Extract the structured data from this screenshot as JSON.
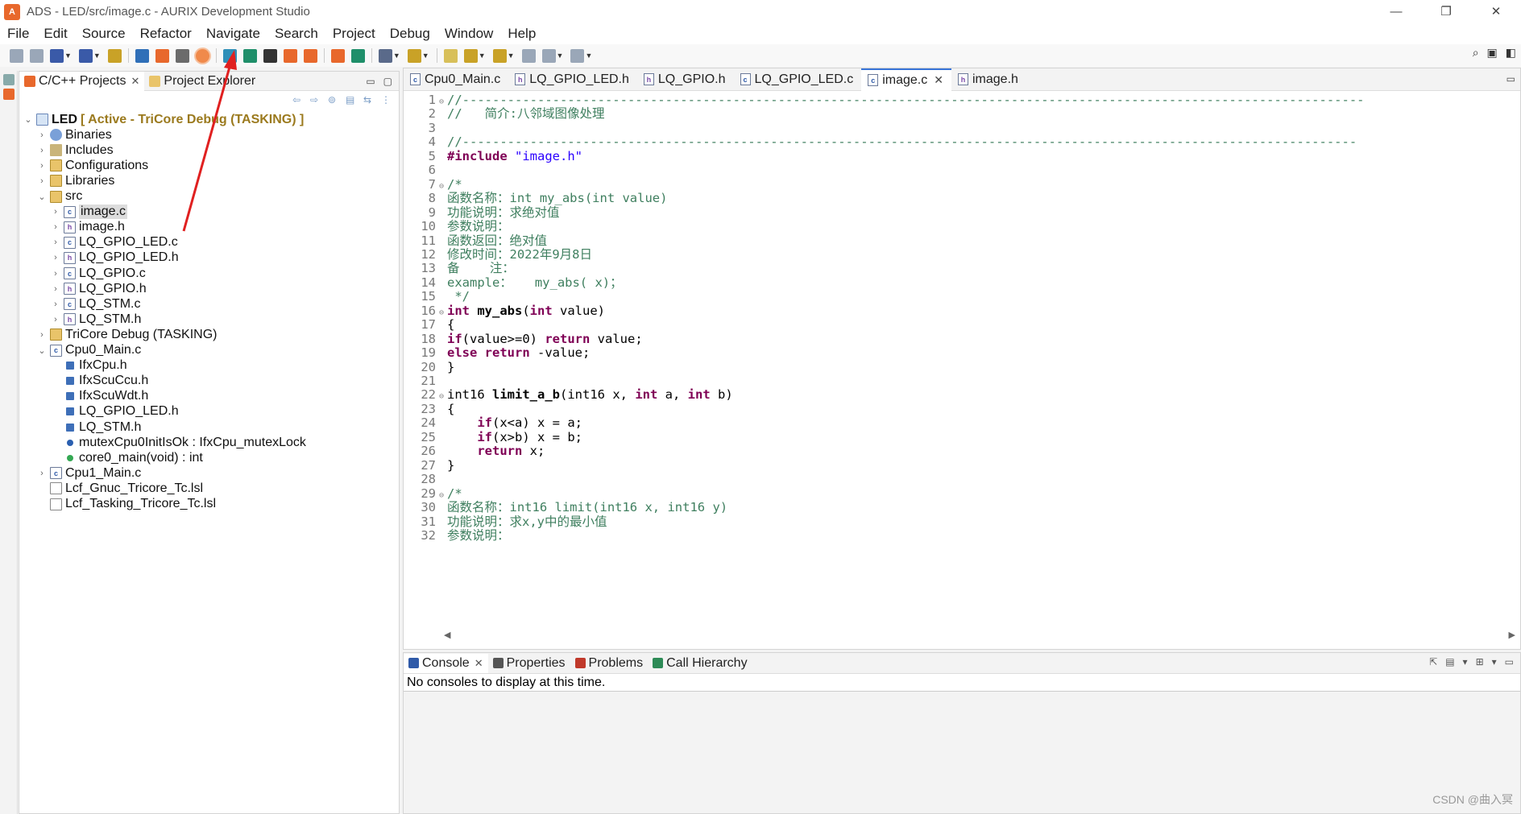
{
  "window": {
    "title": "ADS - LED/src/image.c - AURIX Development Studio",
    "app_icon": "ads-logo-icon",
    "controls": {
      "minimize": "—",
      "maximize": "❐",
      "close": "✕"
    }
  },
  "menu": [
    "File",
    "Edit",
    "Source",
    "Refactor",
    "Navigate",
    "Search",
    "Project",
    "Debug",
    "Window",
    "Help"
  ],
  "toolbar": {
    "icons": [
      {
        "name": "save-icon",
        "color": "#9aa7b8"
      },
      {
        "name": "save-all-icon",
        "color": "#9aa7b8"
      },
      {
        "name": "build-hammer-icon",
        "color": "#3a5aa8",
        "drop": true
      },
      {
        "name": "manage-configs-icon",
        "color": "#3a5aa8",
        "drop": true
      },
      {
        "name": "key-icon",
        "color": "#c9a227"
      },
      {
        "name": "sep"
      },
      {
        "name": "terminal-icon",
        "color": "#2f6fb8"
      },
      {
        "name": "flash-icon",
        "color": "#e8682c"
      },
      {
        "name": "board-icon",
        "color": "#6b6b6b"
      },
      {
        "name": "highlighted-tool-icon",
        "color": "#f08a4b"
      },
      {
        "name": "sep"
      },
      {
        "name": "package-icon",
        "color": "#2f8fb8"
      },
      {
        "name": "chip-icon",
        "color": "#1f8f6a"
      },
      {
        "name": "help-icon",
        "color": "#333"
      },
      {
        "name": "mail-icon",
        "color": "#e8682c"
      },
      {
        "name": "msg-icon",
        "color": "#e8682c"
      },
      {
        "name": "sep"
      },
      {
        "name": "module-icon",
        "color": "#e8682c"
      },
      {
        "name": "shield-icon",
        "color": "#1f8f6a"
      },
      {
        "name": "sep"
      },
      {
        "name": "debug-bug-icon",
        "color": "#5a6a8a",
        "drop": true
      },
      {
        "name": "run-external-icon",
        "color": "#c9a227",
        "drop": true
      },
      {
        "name": "sep"
      },
      {
        "name": "highlight-pen-icon",
        "color": "#d8c05a"
      },
      {
        "name": "next-annotation-icon",
        "color": "#c9a227",
        "drop": true
      },
      {
        "name": "prev-annotation-icon",
        "color": "#c9a227",
        "drop": true
      },
      {
        "name": "last-edit-icon",
        "color": "#9aa7b8"
      },
      {
        "name": "back-icon",
        "color": "#9aa7b8",
        "drop": true
      },
      {
        "name": "forward-icon",
        "color": "#9aa7b8",
        "drop": true
      }
    ],
    "right": [
      "search-icon",
      "open-perspective-icon",
      "cpp-perspective-icon"
    ],
    "right_glyphs": [
      "⌕",
      "▣",
      "◧"
    ]
  },
  "explorer": {
    "tabs": [
      {
        "label": "C/C++ Projects",
        "close": "✕",
        "active": true
      },
      {
        "label": "Project Explorer",
        "active": false
      }
    ],
    "view_controls": [
      "▭",
      "▢"
    ],
    "subbar_icons": [
      "⇦",
      "⇨",
      "⊚",
      "▤",
      "⇆",
      "⋮"
    ],
    "tree": [
      {
        "depth": 0,
        "expanded": true,
        "icon": "proj",
        "label": "LED",
        "bold": true,
        "suffix": "[ Active - TriCore Debug (TASKING) ]"
      },
      {
        "depth": 1,
        "expanded": false,
        "icon": "bin",
        "label": "Binaries"
      },
      {
        "depth": 1,
        "expanded": false,
        "icon": "inc",
        "label": "Includes"
      },
      {
        "depth": 1,
        "expanded": false,
        "icon": "folder",
        "label": "Configurations"
      },
      {
        "depth": 1,
        "expanded": false,
        "icon": "folder",
        "label": "Libraries"
      },
      {
        "depth": 1,
        "expanded": true,
        "icon": "folder",
        "label": "src"
      },
      {
        "depth": 2,
        "expanded": false,
        "icon": "cfile",
        "label": "image.c",
        "selected": true
      },
      {
        "depth": 2,
        "expanded": false,
        "icon": "hfile",
        "label": "image.h"
      },
      {
        "depth": 2,
        "expanded": false,
        "icon": "cfile",
        "label": "LQ_GPIO_LED.c"
      },
      {
        "depth": 2,
        "expanded": false,
        "icon": "hfile",
        "label": "LQ_GPIO_LED.h"
      },
      {
        "depth": 2,
        "expanded": false,
        "icon": "cfile",
        "label": "LQ_GPIO.c"
      },
      {
        "depth": 2,
        "expanded": false,
        "icon": "hfile",
        "label": "LQ_GPIO.h"
      },
      {
        "depth": 2,
        "expanded": false,
        "icon": "cfile",
        "label": "LQ_STM.c"
      },
      {
        "depth": 2,
        "expanded": false,
        "icon": "hfile",
        "label": "LQ_STM.h"
      },
      {
        "depth": 1,
        "expanded": false,
        "icon": "folder",
        "label": "TriCore Debug (TASKING)"
      },
      {
        "depth": 1,
        "expanded": true,
        "icon": "cfile",
        "label": "Cpu0_Main.c"
      },
      {
        "depth": 2,
        "icon": "incfile",
        "label": "IfxCpu.h"
      },
      {
        "depth": 2,
        "icon": "incfile",
        "label": "IfxScuCcu.h"
      },
      {
        "depth": 2,
        "icon": "incfile",
        "label": "IfxScuWdt.h"
      },
      {
        "depth": 2,
        "icon": "incfile",
        "label": "LQ_GPIO_LED.h"
      },
      {
        "depth": 2,
        "icon": "incfile",
        "label": "LQ_STM.h"
      },
      {
        "depth": 2,
        "icon": "dotblue",
        "label": "mutexCpu0InitIsOk : IfxCpu_mutexLock"
      },
      {
        "depth": 2,
        "icon": "dotgreen",
        "label": "core0_main(void) : int"
      },
      {
        "depth": 1,
        "expanded": false,
        "icon": "cfile",
        "label": "Cpu1_Main.c"
      },
      {
        "depth": 1,
        "icon": "lsl",
        "label": "Lcf_Gnuc_Tricore_Tc.lsl"
      },
      {
        "depth": 1,
        "icon": "lsl",
        "label": "Lcf_Tasking_Tricore_Tc.lsl"
      }
    ]
  },
  "editor": {
    "tabs": [
      {
        "label": "Cpu0_Main.c",
        "ftype": "c"
      },
      {
        "label": "LQ_GPIO_LED.h",
        "ftype": "h"
      },
      {
        "label": "LQ_GPIO.h",
        "ftype": "h"
      },
      {
        "label": "LQ_GPIO_LED.c",
        "ftype": "c"
      },
      {
        "label": "image.c",
        "ftype": "c",
        "active": true,
        "close": "✕"
      },
      {
        "label": "image.h",
        "ftype": "h"
      }
    ],
    "tab_menu": "▭",
    "scroll_left": "◀",
    "scroll_right": "▶",
    "lines": [
      {
        "n": "1",
        "fold": "⊖",
        "seg": [
          [
            "c",
            "//------------------------------------------------------------------------------------------------------------------------"
          ]
        ]
      },
      {
        "n": "2",
        "seg": [
          [
            "c",
            "//   简介:八邻域图像处理"
          ]
        ]
      },
      {
        "n": "3",
        "seg": []
      },
      {
        "n": "4",
        "seg": [
          [
            "c",
            "//-----------------------------------------------------------------------------------------------------------------------"
          ]
        ]
      },
      {
        "n": "5",
        "seg": [
          [
            "k",
            "#include "
          ],
          [
            "s",
            "\"image.h\""
          ]
        ]
      },
      {
        "n": "6",
        "seg": []
      },
      {
        "n": "7",
        "fold": "⊖",
        "seg": [
          [
            "c",
            "/*"
          ]
        ]
      },
      {
        "n": "8",
        "seg": [
          [
            "c",
            "函数名称：int my_abs(int value)"
          ]
        ]
      },
      {
        "n": "9",
        "seg": [
          [
            "c",
            "功能说明：求绝对值"
          ]
        ]
      },
      {
        "n": "10",
        "seg": [
          [
            "c",
            "参数说明："
          ]
        ]
      },
      {
        "n": "11",
        "seg": [
          [
            "c",
            "函数返回：绝对值"
          ]
        ]
      },
      {
        "n": "12",
        "seg": [
          [
            "c",
            "修改时间：2022年9月8日"
          ]
        ]
      },
      {
        "n": "13",
        "seg": [
          [
            "c",
            "备    注："
          ]
        ]
      },
      {
        "n": "14",
        "seg": [
          [
            "c",
            "example：   my_abs( x)；"
          ]
        ]
      },
      {
        "n": "15",
        "seg": [
          [
            "c",
            " */"
          ]
        ]
      },
      {
        "n": "16",
        "fold": "⊖",
        "seg": [
          [
            "k",
            "int "
          ],
          [
            "f",
            "my_abs"
          ],
          [
            "p",
            "("
          ],
          [
            "k",
            "int"
          ],
          [
            "p",
            " value)"
          ]
        ]
      },
      {
        "n": "17",
        "seg": [
          [
            "p",
            "{"
          ]
        ]
      },
      {
        "n": "18",
        "seg": [
          [
            "k",
            "if"
          ],
          [
            "p",
            "(value>=0) "
          ],
          [
            "k",
            "return"
          ],
          [
            "p",
            " value;"
          ]
        ]
      },
      {
        "n": "19",
        "seg": [
          [
            "k",
            "else return"
          ],
          [
            "p",
            " -value;"
          ]
        ]
      },
      {
        "n": "20",
        "seg": [
          [
            "p",
            "}"
          ]
        ]
      },
      {
        "n": "21",
        "seg": []
      },
      {
        "n": "22",
        "fold": "⊖",
        "seg": [
          [
            "p",
            "int16 "
          ],
          [
            "f",
            "limit_a_b"
          ],
          [
            "p",
            "(int16 x, "
          ],
          [
            "k",
            "int"
          ],
          [
            "p",
            " a, "
          ],
          [
            "k",
            "int"
          ],
          [
            "p",
            " b)"
          ]
        ]
      },
      {
        "n": "23",
        "seg": [
          [
            "p",
            "{"
          ]
        ]
      },
      {
        "n": "24",
        "seg": [
          [
            "p",
            "    "
          ],
          [
            "k",
            "if"
          ],
          [
            "p",
            "(x<a) x = a;"
          ]
        ]
      },
      {
        "n": "25",
        "seg": [
          [
            "p",
            "    "
          ],
          [
            "k",
            "if"
          ],
          [
            "p",
            "(x>b) x = b;"
          ]
        ]
      },
      {
        "n": "26",
        "seg": [
          [
            "p",
            "    "
          ],
          [
            "k",
            "return"
          ],
          [
            "p",
            " x;"
          ]
        ]
      },
      {
        "n": "27",
        "seg": [
          [
            "p",
            "}"
          ]
        ]
      },
      {
        "n": "28",
        "seg": []
      },
      {
        "n": "29",
        "fold": "⊖",
        "seg": [
          [
            "c",
            "/*"
          ]
        ]
      },
      {
        "n": "30",
        "seg": [
          [
            "c",
            "函数名称：int16 limit(int16 x, int16 y)"
          ]
        ]
      },
      {
        "n": "31",
        "seg": [
          [
            "c",
            "功能说明：求x,y中的最小值"
          ]
        ]
      },
      {
        "n": "32",
        "seg": [
          [
            "c",
            "参数说明："
          ]
        ]
      }
    ]
  },
  "console": {
    "tabs": [
      {
        "label": "Console",
        "close": "✕",
        "icon_color": "#2f5aa8",
        "active": true
      },
      {
        "label": "Properties",
        "icon_color": "#555"
      },
      {
        "label": "Problems",
        "icon_color": "#c0392b"
      },
      {
        "label": "Call Hierarchy",
        "icon_color": "#2e8b57"
      }
    ],
    "ctrls": [
      "⇱",
      "▤",
      "▾",
      "⊞",
      "▾",
      "▭"
    ],
    "message": "No consoles to display at this time."
  },
  "watermark": "CSDN @曲入冥"
}
